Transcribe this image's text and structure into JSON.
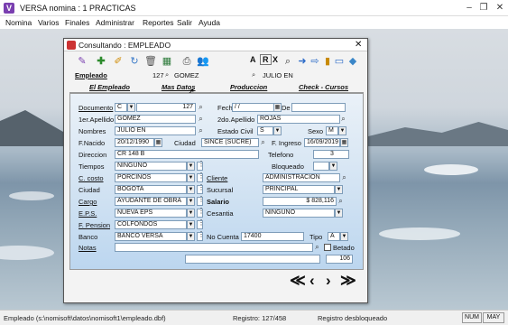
{
  "app": {
    "title": "VERSA nomina : 1 PRACTICAS"
  },
  "menu": [
    "Nomina",
    "Varios",
    "Finales",
    "Administrar",
    "Reportes",
    "Salir",
    "Ayuda"
  ],
  "dialog": {
    "title": "Consultando : EMPLEADO",
    "record_no": "127",
    "record_name": "GOMEZ",
    "mode_letters": [
      "A",
      "R",
      "X"
    ],
    "record_name2": "JULIO EN"
  },
  "section_label": "Empleado",
  "tabs": [
    "El Empleado",
    "Mas Datos",
    "Produccion",
    "Check - Cursos"
  ],
  "form": {
    "documento": {
      "label": "Documento",
      "type": "C",
      "value": "127"
    },
    "fecha": {
      "label": "Fecha",
      "value": "/ /",
      "de_label": "De"
    },
    "apellido1": {
      "label": "1er.Apellido",
      "value": "GOMEZ"
    },
    "apellido2": {
      "label": "2do.Apellido",
      "value": "ROJAS"
    },
    "nombres": {
      "label": "Nombres",
      "value": "JULIO EN"
    },
    "estado_civil": {
      "label": "Estado Civil",
      "value": "S"
    },
    "sexo": {
      "label": "Sexo",
      "value": "M"
    },
    "fnacido": {
      "label": "F.Nacido",
      "value": "20/12/1990"
    },
    "ciudad": {
      "label": "Ciudad",
      "value": "SINCE (SUCRE)"
    },
    "fingreso": {
      "label": "F. Ingreso",
      "value": "16/09/2019"
    },
    "direccion": {
      "label": "Direccion",
      "value": "CR 148 B"
    },
    "telefono": {
      "label": "Telefono",
      "value": "3"
    },
    "tiempos": {
      "label": "Tiempos",
      "value": "NINGUNO"
    },
    "bloqueado": {
      "label": "Bloqueado",
      "value": ""
    },
    "ccosto": {
      "label": "C. costo",
      "value": "PORCINOS"
    },
    "cliente": {
      "label": "Cliente",
      "value": "ADMINISTRACION"
    },
    "ciudad2": {
      "label": "Ciudad",
      "value": "BOGOTA"
    },
    "sucursal": {
      "label": "Sucursal",
      "value": "PRINCIPAL"
    },
    "cargo": {
      "label": "Cargo",
      "value": "AYUDANTE DE OBRA"
    },
    "salario": {
      "label": "Salario",
      "value": "$ 828,116"
    },
    "eps": {
      "label": "E.P.S.",
      "value": "NUEVA EPS"
    },
    "cesantia": {
      "label": "Cesantia",
      "value": "NINGUNO"
    },
    "fpension": {
      "label": "F. Pension",
      "value": "COLFONDOS"
    },
    "banco": {
      "label": "Banco",
      "value": "BANCO VERSA"
    },
    "nocuenta": {
      "label": "No Cuenta",
      "value": "17400"
    },
    "tipo": {
      "label": "Tipo",
      "value": "A"
    },
    "betado": {
      "label": "Betado"
    },
    "notas": {
      "label": "Notas",
      "value": ""
    },
    "count": "106"
  },
  "nav": [
    "≪",
    "‹",
    "›",
    "≫"
  ],
  "status": {
    "path": "Empleado (s:\\nomisoft\\datos\\nomisoft1\\empleado.dbf)",
    "registro": "Registro: 127/458",
    "estado": "Registro desbloqueado",
    "num": "NUM",
    "may": "MAY"
  }
}
